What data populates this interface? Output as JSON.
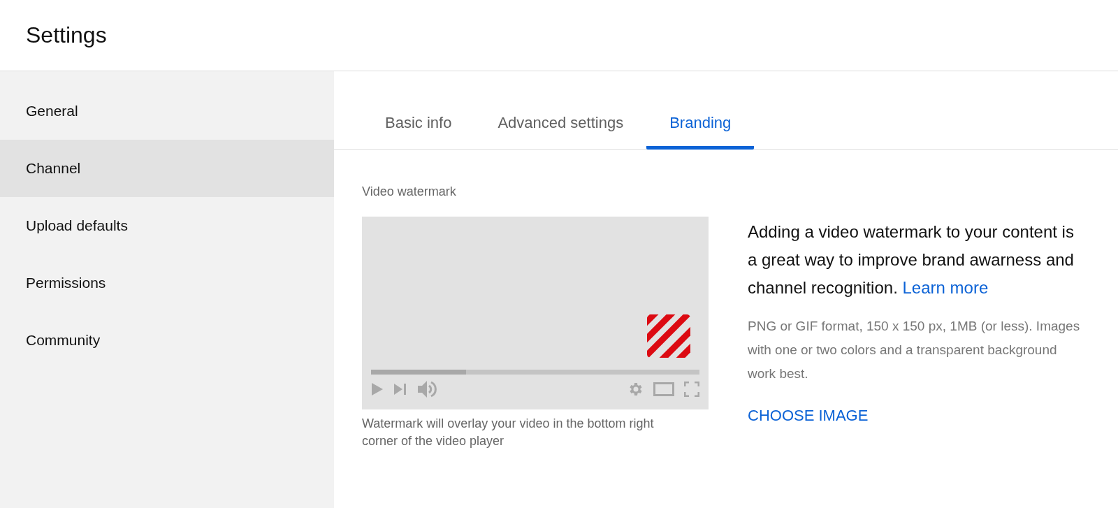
{
  "header": {
    "title": "Settings"
  },
  "sidebar": {
    "items": [
      {
        "label": "General",
        "selected": false
      },
      {
        "label": "Channel",
        "selected": true
      },
      {
        "label": "Upload defaults",
        "selected": false
      },
      {
        "label": "Permissions",
        "selected": false
      },
      {
        "label": "Community",
        "selected": false
      }
    ]
  },
  "tabs": [
    {
      "label": "Basic info",
      "selected": false
    },
    {
      "label": "Advanced settings",
      "selected": false
    },
    {
      "label": "Branding",
      "selected": true
    }
  ],
  "watermark": {
    "heading": "Video watermark",
    "player": {
      "progress": {
        "level": 0.29
      }
    },
    "caption": "Watermark will overlay your video in the bottom right corner of the video player",
    "description": "Adding a video watermark to your content is a great way to improve brand awarness and channel recognition.",
    "link": "Learn more",
    "requirements": "PNG or GIF format, 150 x 150 px, 1MB (or less). Images with one or two colors and a transparent background work best.",
    "button": "CHOOSE IMAGE"
  }
}
